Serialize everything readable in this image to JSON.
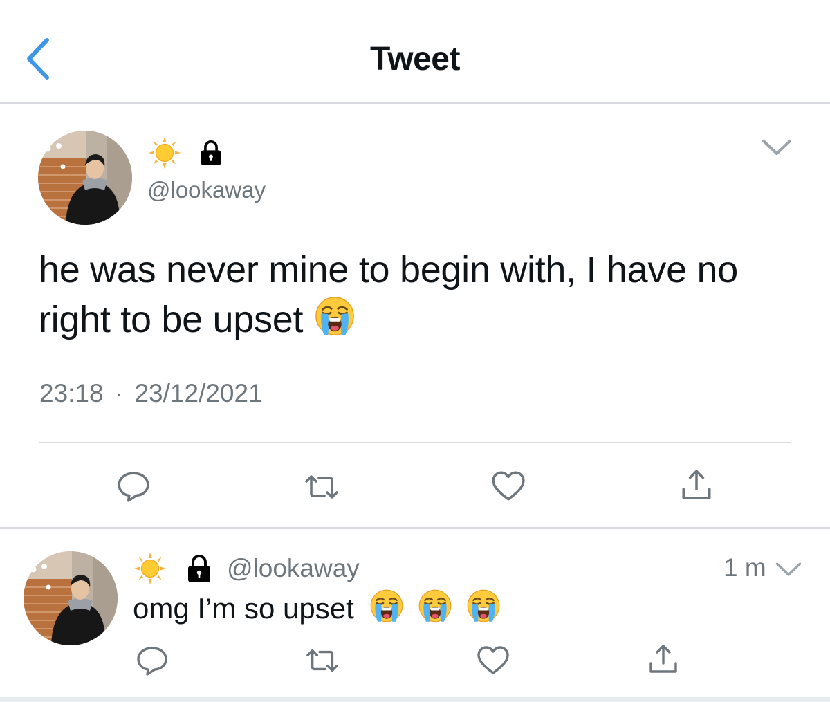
{
  "header": {
    "title": "Tweet",
    "back_icon": "chevron-left-icon",
    "accent_color": "#3e96e8"
  },
  "main_tweet": {
    "display_name_icons": [
      "sun-emoji-icon",
      "lock-icon"
    ],
    "handle": "@lookaway",
    "text": "he was never mine to begin with, I have no right to be upset",
    "text_emoji": "loudly-crying-face-emoji",
    "time": "23:18",
    "separator": "·",
    "date": "23/12/2021",
    "menu_icon": "chevron-down-icon",
    "actions": [
      {
        "name": "reply",
        "icon": "comment-icon"
      },
      {
        "name": "retweet",
        "icon": "retweet-icon"
      },
      {
        "name": "like",
        "icon": "heart-icon"
      },
      {
        "name": "share",
        "icon": "share-icon"
      }
    ]
  },
  "reply_tweet": {
    "display_name_icons": [
      "sun-emoji-icon",
      "lock-icon"
    ],
    "handle": "@lookaway",
    "time_ago": "1 m",
    "text": "omg I’m so upset",
    "text_emojis": [
      "loudly-crying-face-emoji",
      "loudly-crying-face-emoji",
      "loudly-crying-face-emoji"
    ],
    "menu_icon": "chevron-down-icon",
    "actions": [
      {
        "name": "reply",
        "icon": "comment-icon"
      },
      {
        "name": "retweet",
        "icon": "retweet-icon"
      },
      {
        "name": "like",
        "icon": "heart-icon"
      },
      {
        "name": "share",
        "icon": "share-icon"
      }
    ]
  },
  "colors": {
    "secondary_text": "#6e767d",
    "icon_gray": "#6e767d",
    "divider": "#d7dbdf"
  }
}
